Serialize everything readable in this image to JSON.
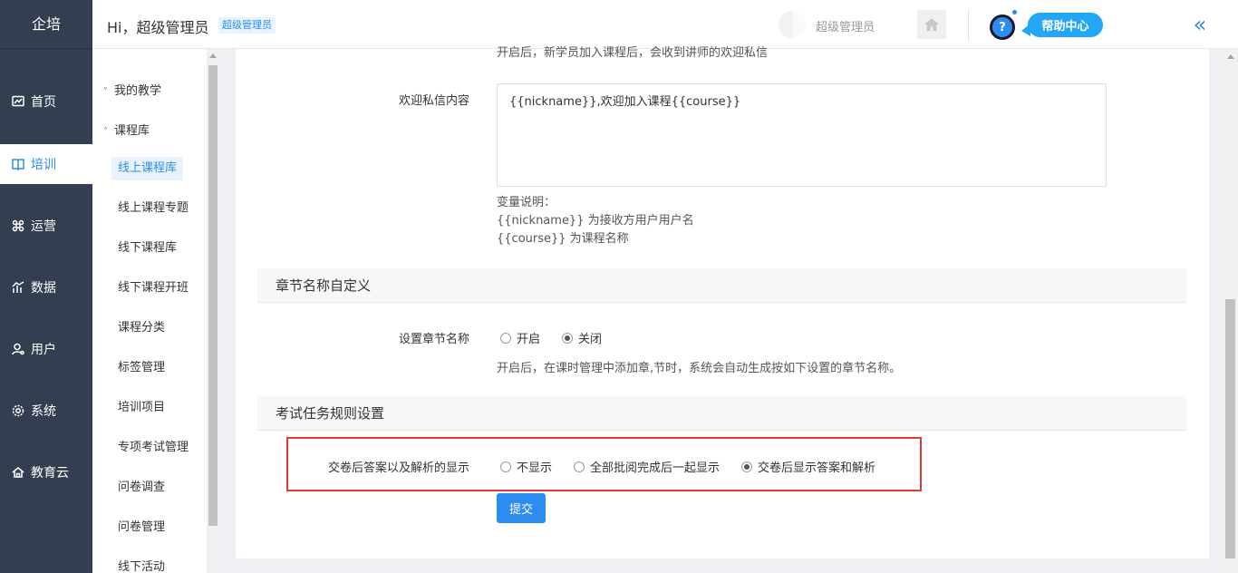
{
  "brand": "企培",
  "nav": {
    "items": [
      {
        "label": "首页",
        "icon": "dashboard-icon"
      },
      {
        "label": "培训",
        "icon": "training-icon"
      },
      {
        "label": "运营",
        "icon": "command-icon"
      },
      {
        "label": "数据",
        "icon": "chart-icon"
      },
      {
        "label": "用户",
        "icon": "user-icon"
      },
      {
        "label": "系统",
        "icon": "settings-icon"
      },
      {
        "label": "教育云",
        "icon": "cloud-icon"
      }
    ],
    "active": "培训"
  },
  "header": {
    "greeting": "Hi，超级管理员",
    "role_badge": "超级管理员",
    "admin_name": "超级管理员",
    "help_label": "帮助中心",
    "help_icon_glyph": "?",
    "collapse_glyph": "«"
  },
  "submenu": {
    "groups": [
      {
        "label": "我的教学",
        "chevron": "˅"
      },
      {
        "label": "课程库",
        "chevron": "˄"
      }
    ],
    "items": [
      "线上课程库",
      "线上课程专题",
      "线下课程库",
      "线下课程开班",
      "课程分类",
      "标签管理",
      "培训项目",
      "专项考试管理",
      "问卷调查",
      "问卷管理",
      "线下活动"
    ],
    "active": "线上课程库"
  },
  "content": {
    "cut_text": "开启后，新学员加入课程后，会收到讲师的欢迎私信",
    "welcome_label": "欢迎私信内容",
    "welcome_value": "{{nickname}},欢迎加入课程{{course}}",
    "var_title": "变量说明：",
    "var_nickname": "{{nickname}} 为接收方用户用户名",
    "var_course": "{{course}} 为课程名称",
    "section_chapter": "章节名称自定义",
    "chapter_label": "设置章节名称",
    "chapter_options": [
      "开启",
      "关闭"
    ],
    "chapter_selected": "关闭",
    "chapter_hint": "开启后，在课时管理中添加章,节时，系统会自动生成按如下设置的章节名称。",
    "section_exam": "考试任务规则设置",
    "answer_label": "交卷后答案以及解析的显示",
    "answer_options": [
      "不显示",
      "全部批阅完成后一起显示",
      "交卷后显示答案和解析"
    ],
    "answer_selected": "交卷后显示答案和解析",
    "submit_label": "提交"
  }
}
